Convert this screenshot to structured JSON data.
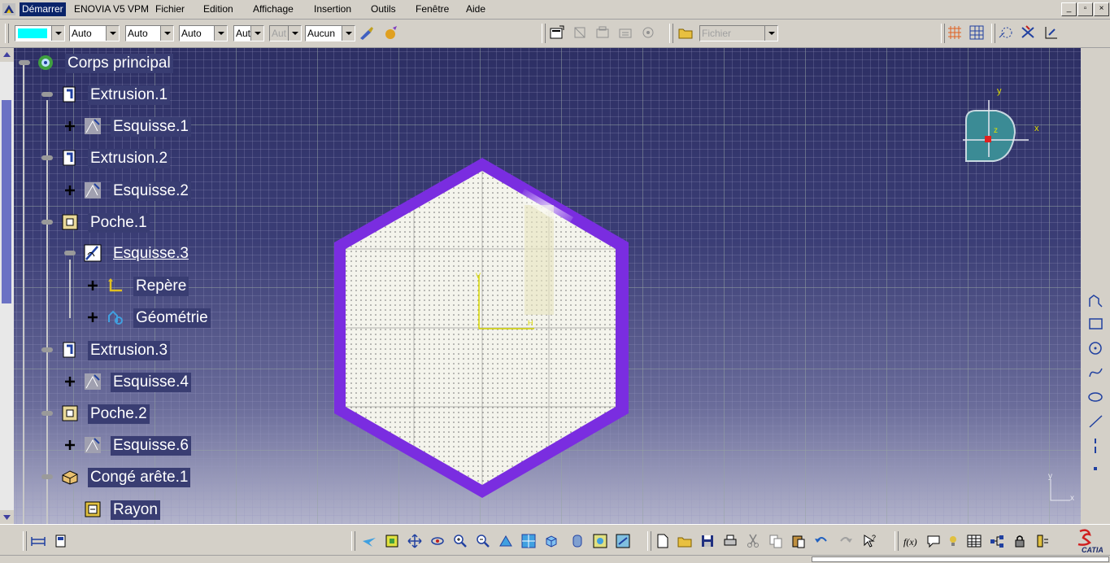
{
  "menu": {
    "items": [
      {
        "key": "start",
        "label": "Démarrer"
      },
      {
        "key": "enovia",
        "label": "ENOVIA V5 VPM"
      },
      {
        "key": "file",
        "label": "Fichier"
      },
      {
        "key": "edit",
        "label": "Edition"
      },
      {
        "key": "view",
        "label": "Affichage"
      },
      {
        "key": "insert",
        "label": "Insertion"
      },
      {
        "key": "tools",
        "label": "Outils"
      },
      {
        "key": "window",
        "label": "Fenêtre"
      },
      {
        "key": "help",
        "label": "Aide"
      }
    ]
  },
  "toolbar": {
    "color_swatch": "#00ffff",
    "linetype_value": "Auto",
    "thickness_value": "Auto",
    "point_value": "Auto",
    "layer_value": "Aut",
    "layer2_value": "Aut",
    "none_value": "Aucun",
    "file_combo_value": "Fichier"
  },
  "tree": {
    "root": "Corps principal",
    "nodes": [
      {
        "label": "Extrusion.1",
        "type": "pad"
      },
      {
        "label": "Esquisse.1",
        "type": "sketch"
      },
      {
        "label": "Extrusion.2",
        "type": "pad"
      },
      {
        "label": "Esquisse.2",
        "type": "sketch"
      },
      {
        "label": "Poche.1",
        "type": "pocket"
      },
      {
        "label": "Esquisse.3",
        "type": "sketch-active"
      },
      {
        "label": "Repère",
        "type": "axis"
      },
      {
        "label": "Géométrie",
        "type": "geometry"
      },
      {
        "label": "Extrusion.3",
        "type": "pad"
      },
      {
        "label": "Esquisse.4",
        "type": "sketch"
      },
      {
        "label": "Poche.2",
        "type": "pocket"
      },
      {
        "label": "Esquisse.6",
        "type": "sketch"
      },
      {
        "label": "Congé arête.1",
        "type": "fillet"
      },
      {
        "label": "Rayon",
        "type": "radius"
      }
    ]
  },
  "compass": {
    "x": "x",
    "y": "y",
    "z": "z"
  },
  "sketch_axes": {
    "h": "H",
    "v": "V"
  },
  "mini_axes": {
    "x": "x",
    "y": "y"
  },
  "colors": {
    "hex_border": "#7a2de0",
    "hex_fill": "#f4f4ec",
    "axis": "#d8d800",
    "menu_active": "#0a246a"
  },
  "brand": "CATIA"
}
